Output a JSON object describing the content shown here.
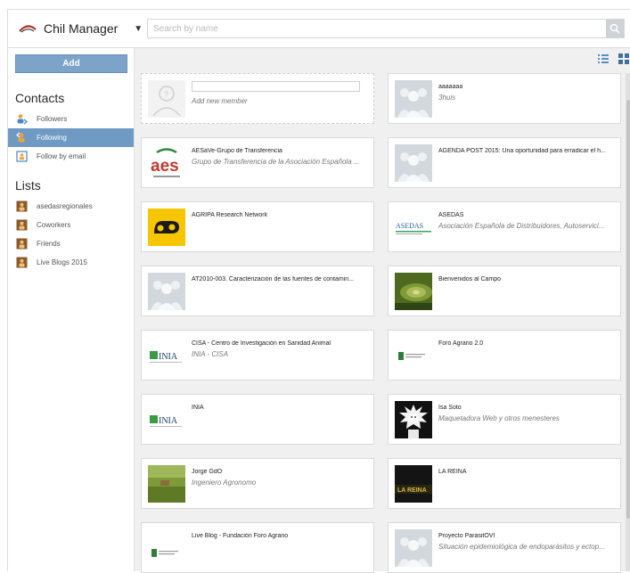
{
  "app": {
    "name": "Chil Manager",
    "search_placeholder": "Search by name"
  },
  "sidebar": {
    "add_label": "Add",
    "contacts_title": "Contacts",
    "contacts": [
      {
        "label": "Followers",
        "icon": "followers-icon",
        "active": false
      },
      {
        "label": "Following",
        "icon": "following-icon",
        "active": true
      },
      {
        "label": "Follow by email",
        "icon": "follow-by-email-icon",
        "active": false
      }
    ],
    "lists_title": "Lists",
    "lists": [
      {
        "label": "asedasregionales",
        "icon": "list-icon"
      },
      {
        "label": "Coworkers",
        "icon": "list-icon"
      },
      {
        "label": "Friends",
        "icon": "list-icon"
      },
      {
        "label": "Live Blogs 2015",
        "icon": "list-icon"
      }
    ]
  },
  "main": {
    "new_member_label": "Add new member",
    "cards": [
      {
        "name": "aaaaaaa",
        "subtitle": "3huis",
        "thumb": "group-placeholder"
      },
      {
        "name": "AESaVe-Grupo de Transferencia",
        "subtitle": "Grupo de Transferencia de la Asociación Española ...",
        "thumb": "aes-logo",
        "logo_text": "aes"
      },
      {
        "name": "AGENDA POST 2015: Una oportunidad para erradicar el h...",
        "subtitle": "",
        "thumb": "group-placeholder"
      },
      {
        "name": "AGRIPA Research Network",
        "subtitle": "",
        "thumb": "agripa-logo"
      },
      {
        "name": "ASEDAS",
        "subtitle": "Asociación Española de Distribuidores, Autoservici...",
        "thumb": "asedas-logo",
        "logo_text": "ASEDAS"
      },
      {
        "name": "AT2010-003. Caracterización de las fuentes de contamin...",
        "subtitle": "",
        "thumb": "group-placeholder"
      },
      {
        "name": "Bienvenidos al Campo",
        "subtitle": "",
        "thumb": "field-photo"
      },
      {
        "name": "CISA - Centro de Investigación en Sanidad Animal",
        "subtitle": "INIA - CISA",
        "thumb": "inia-logo",
        "logo_text": "INIA"
      },
      {
        "name": "Foro Agrario 2.0",
        "subtitle": "",
        "thumb": "foro-logo"
      },
      {
        "name": "INIA",
        "subtitle": "",
        "thumb": "inia-logo",
        "logo_text": "INIA"
      },
      {
        "name": "Isa Soto",
        "subtitle": "Maquetadora Web y otros menesteres",
        "thumb": "avatar-illustration"
      },
      {
        "name": "Jorge GdO",
        "subtitle": "Ingeniero Agronomo",
        "thumb": "farm-photo"
      },
      {
        "name": "LA REINA",
        "subtitle": "",
        "thumb": "la-reina-logo",
        "logo_text": "LA REINA"
      },
      {
        "name": "Live Blog - Fundación Foro Agrario",
        "subtitle": "",
        "thumb": "foro-logo"
      },
      {
        "name": "Proyecto ParasitOVI",
        "subtitle": "Situación epidemiológica de endoparásitos y ectop...",
        "thumb": "group-placeholder"
      }
    ]
  },
  "colors": {
    "accent": "#6f9ac4",
    "add_button": "#7ea3c9",
    "main_bg": "#f0f0f0",
    "aes_red": "#c0392b",
    "aes_green": "#2e8b3a",
    "agripa_yellow": "#f7c600"
  }
}
